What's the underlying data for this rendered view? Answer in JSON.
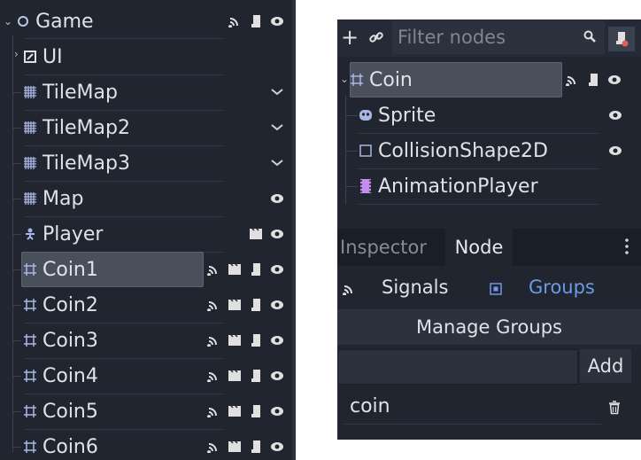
{
  "scene_tree_left": {
    "nodes": [
      {
        "name": "Game"
      },
      {
        "name": "UI"
      },
      {
        "name": "TileMap"
      },
      {
        "name": "TileMap2"
      },
      {
        "name": "TileMap3"
      },
      {
        "name": "Map"
      },
      {
        "name": "Player"
      },
      {
        "name": "Coin1"
      },
      {
        "name": "Coin2"
      },
      {
        "name": "Coin3"
      },
      {
        "name": "Coin4"
      },
      {
        "name": "Coin5"
      },
      {
        "name": "Coin6"
      }
    ]
  },
  "scene_panel": {
    "filter_placeholder": "Filter nodes",
    "nodes": [
      {
        "name": "Coin"
      },
      {
        "name": "Sprite"
      },
      {
        "name": "CollisionShape2D"
      },
      {
        "name": "AnimationPlayer"
      }
    ]
  },
  "dock": {
    "tabs": [
      {
        "label": "Inspector"
      },
      {
        "label": "Node"
      }
    ],
    "subtabs": [
      {
        "label": "Signals"
      },
      {
        "label": "Groups"
      }
    ],
    "manage_groups_label": "Manage Groups",
    "add_label": "Add",
    "groups": [
      {
        "name": "coin"
      }
    ]
  },
  "colors": {
    "panel_bg": "#20252f",
    "accent": "#6c9ae6",
    "icon_grey": "#e0e0e0"
  }
}
